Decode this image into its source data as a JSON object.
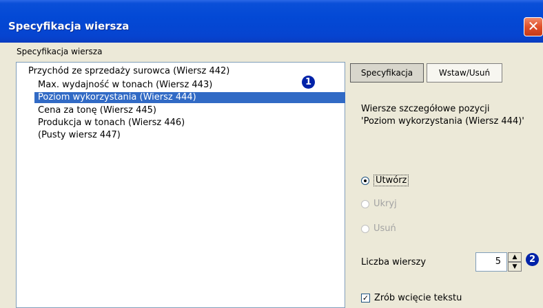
{
  "window": {
    "title": "Specyfikacja wiersza",
    "close_glyph": "✕"
  },
  "group": {
    "label": "Specyfikacja wiersza"
  },
  "tree": {
    "items": [
      {
        "label": "Przychód ze sprzedaży surowca (Wiersz 442)",
        "selected": false
      },
      {
        "label": "Max. wydajność w tonach (Wiersz 443)",
        "selected": false
      },
      {
        "label": "Poziom wykorzystania (Wiersz 444)",
        "selected": true
      },
      {
        "label": "Cena za tonę (Wiersz 445)",
        "selected": false
      },
      {
        "label": "Produkcja w tonach (Wiersz 446)",
        "selected": false
      },
      {
        "label": "(Pusty wiersz 447)",
        "selected": false
      }
    ]
  },
  "markers": {
    "one": "1",
    "two": "2"
  },
  "tabs": [
    {
      "label": "Specyfikacja",
      "active": true
    },
    {
      "label": "Wstaw/Usuń",
      "active": false
    }
  ],
  "panel": {
    "description": "Wiersze szczegółowe pozycji 'Poziom wykorzystania (Wiersz 444)'",
    "radios": [
      {
        "label": "Utwórz",
        "checked": true,
        "enabled": true
      },
      {
        "label": "Ukryj",
        "checked": false,
        "enabled": false
      },
      {
        "label": "Usuń",
        "checked": false,
        "enabled": false
      }
    ],
    "row_count_label": "Liczba wierszy",
    "row_count_value": "5",
    "indent_label": "Zrób wcięcie tekstu",
    "indent_checked": true
  },
  "colors": {
    "title_bar": "#0349d5",
    "dialog_bg": "#ece9d8",
    "selection": "#316ac5",
    "marker": "#0022a8",
    "close": "#e0502a"
  }
}
